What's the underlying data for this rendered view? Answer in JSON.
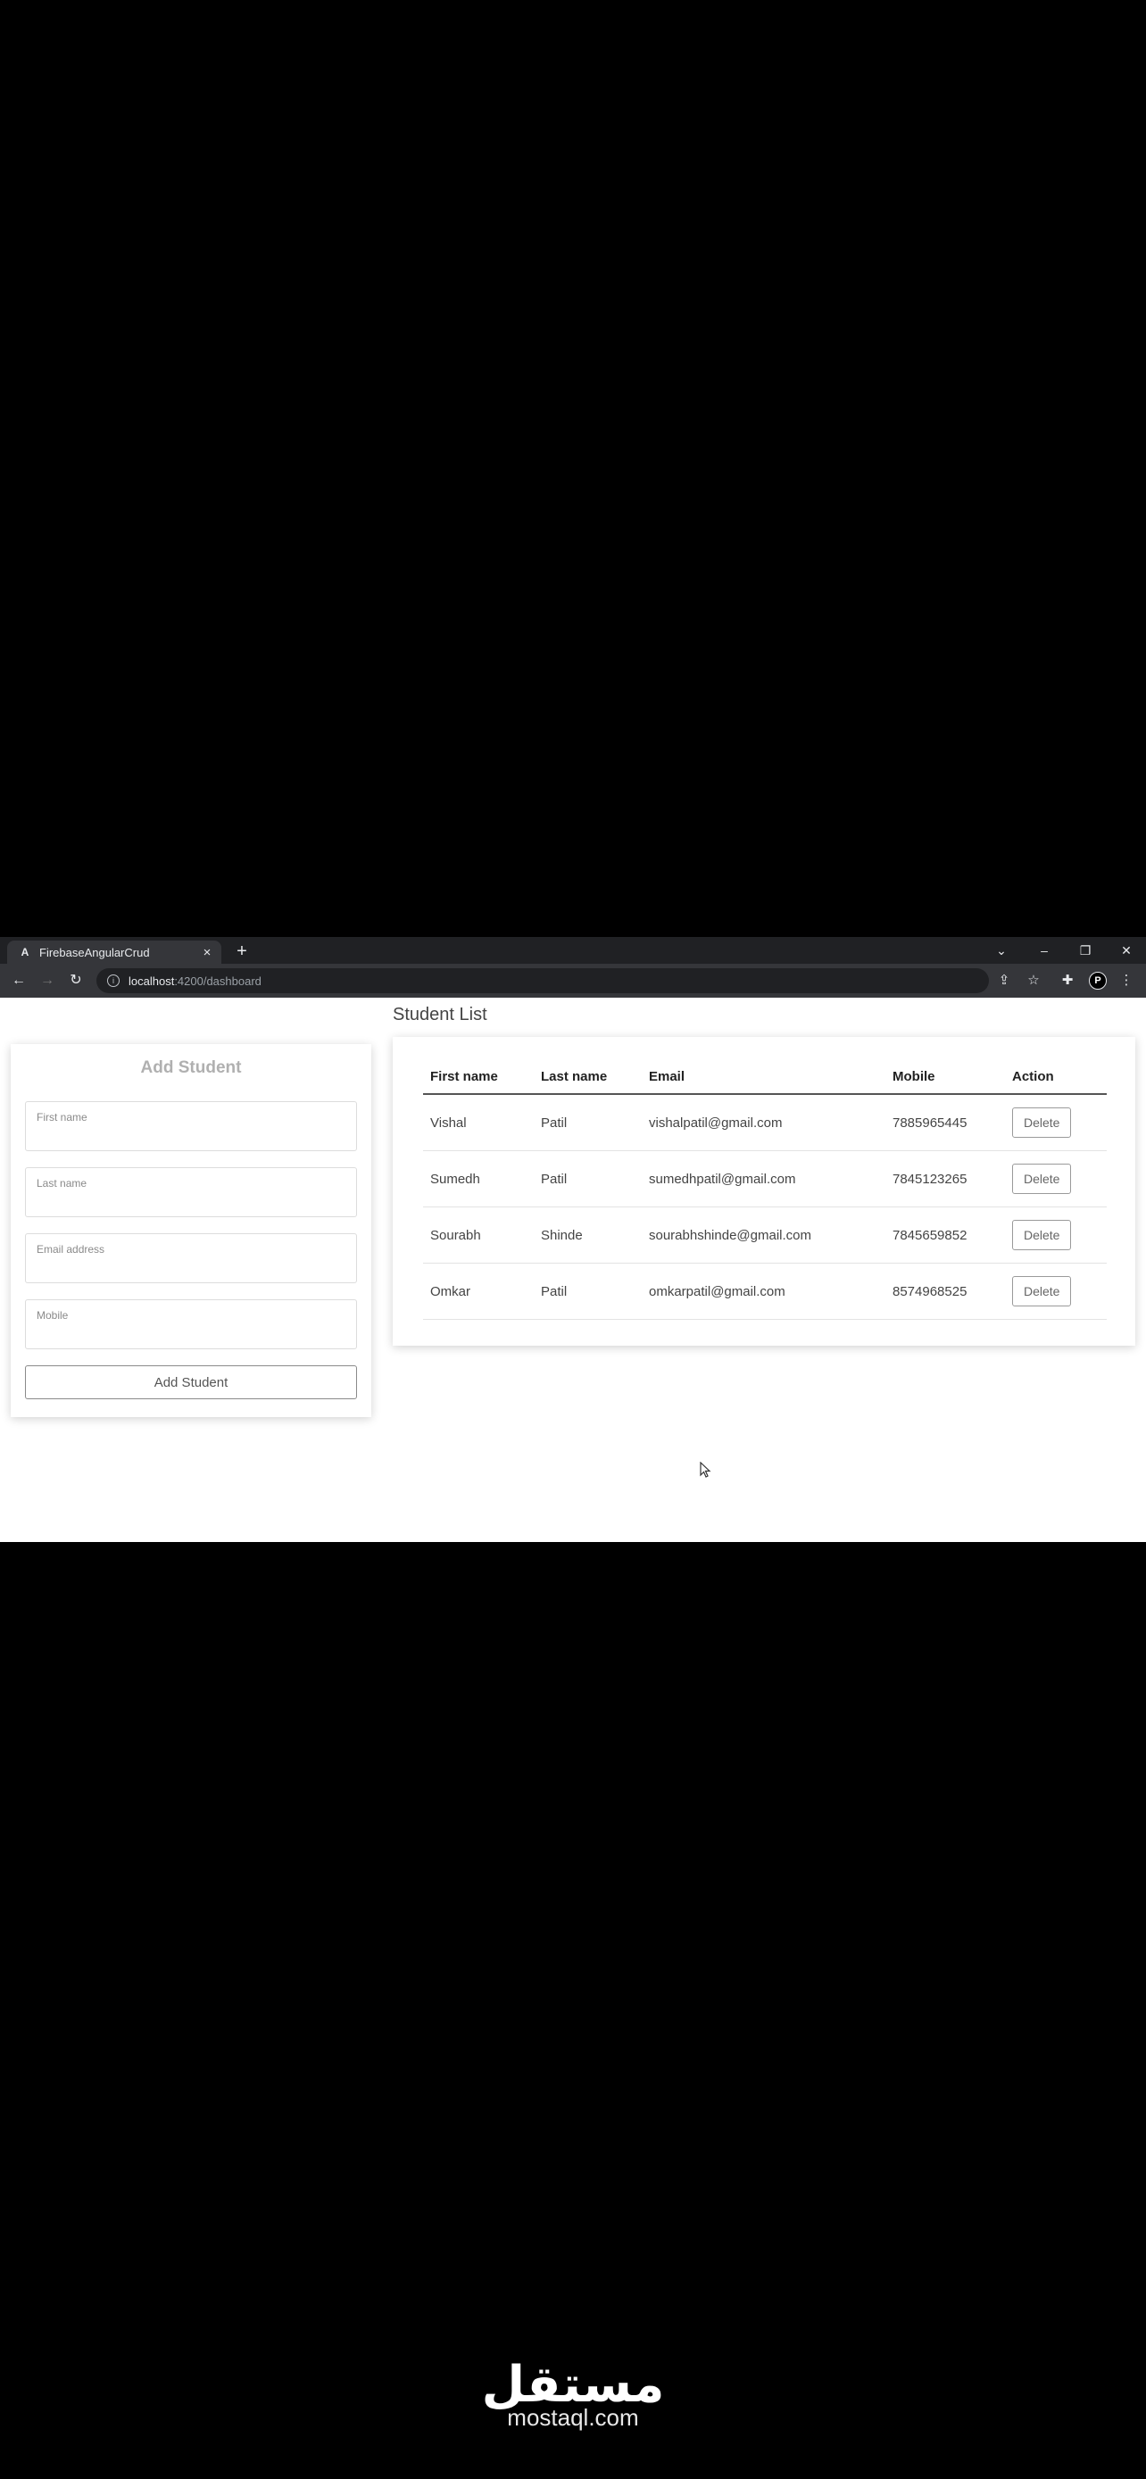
{
  "browser": {
    "tab_title": "FirebaseAngularCrud",
    "tab_favicon": "A",
    "url_host": "localhost",
    "url_path": ":4200/dashboard",
    "profile_initial": "P"
  },
  "icons": {
    "back": "back-arrow-icon",
    "forward": "forward-arrow-icon",
    "reload": "reload-icon",
    "info": "info-icon",
    "share": "share-icon",
    "star": "star-icon",
    "extensions": "puzzle-icon",
    "menu": "kebab-menu-icon",
    "close": "close-icon",
    "new_tab": "plus-icon",
    "minimize": "minimize-icon",
    "restore": "restore-icon"
  },
  "add_form": {
    "title": "Add Student",
    "first_name_label": "First name",
    "last_name_label": "Last name",
    "email_label": "Email address",
    "mobile_label": "Mobile",
    "submit_label": "Add Student"
  },
  "student_list": {
    "title": "Student List",
    "columns": [
      "First name",
      "Last name",
      "Email",
      "Mobile",
      "Action"
    ],
    "rows": [
      {
        "first": "Vishal",
        "last": "Patil",
        "email": "vishalpatil@gmail.com",
        "mobile": "7885965445",
        "action": "Delete"
      },
      {
        "first": "Sumedh",
        "last": "Patil",
        "email": "sumedhpatil@gmail.com",
        "mobile": "7845123265",
        "action": "Delete"
      },
      {
        "first": "Sourabh",
        "last": "Shinde",
        "email": "sourabhshinde@gmail.com",
        "mobile": "7845659852",
        "action": "Delete"
      },
      {
        "first": "Omkar",
        "last": "Patil",
        "email": "omkarpatil@gmail.com",
        "mobile": "8574968525",
        "action": "Delete"
      }
    ]
  },
  "watermark": {
    "arabic": "مستقل",
    "latin": "mostaql.com"
  },
  "colors": {
    "chrome_dark": "#202124",
    "chrome_toolbar": "#35363a",
    "page_bg": "#ffffff",
    "outer_bg": "#000000"
  }
}
